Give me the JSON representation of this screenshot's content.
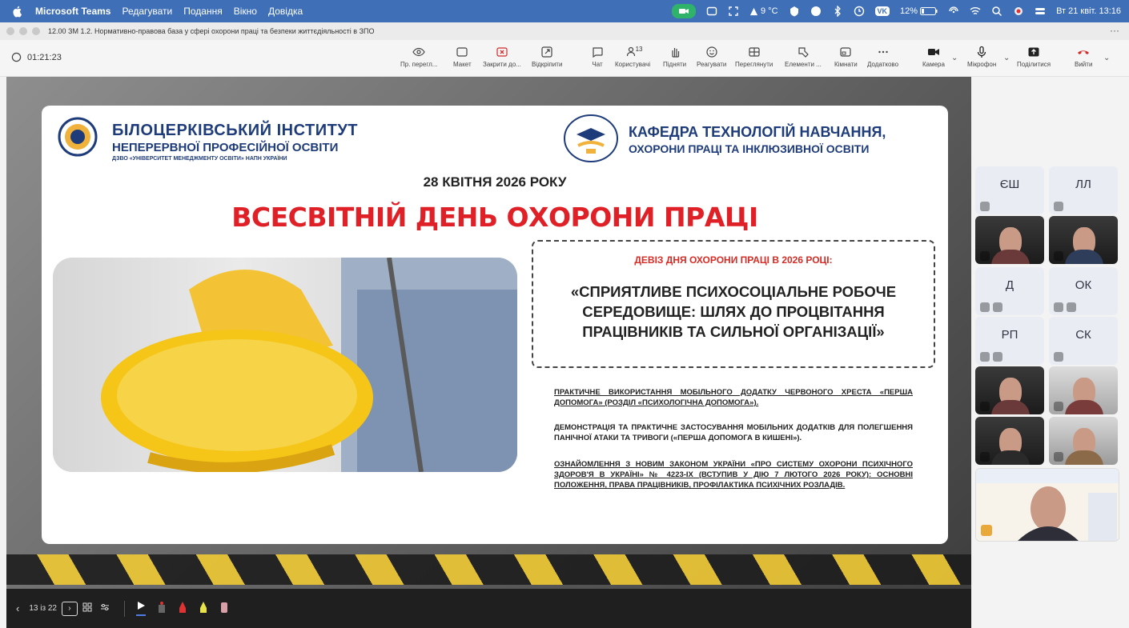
{
  "menubar": {
    "app_name": "Microsoft Teams",
    "items": [
      "Редагувати",
      "Подання",
      "Вікно",
      "Довідка"
    ],
    "temperature": "9 °C",
    "vk_label": "VK",
    "battery": "12%",
    "datetime": "Вт 21 квіт. 13:16"
  },
  "window": {
    "title": "12.00 ЗМ 1.2. Нормативно-правова база у сфері охорони праці та безпеки життєдіяльності в ЗПО",
    "more": "···"
  },
  "toolbar": {
    "timer": "01:21:23",
    "buttons": {
      "preview": "Пр. перегл...",
      "layout": "Макет",
      "close": "Закрити до...",
      "pin": "Відкріпити",
      "chat": "Чат",
      "people": "Користувачі",
      "people_count": "13",
      "raise": "Підняти",
      "react": "Реагувати",
      "view": "Переглянути",
      "elements": "Елементи ...",
      "rooms": "Кімнати",
      "more": "Додатково",
      "camera": "Камера",
      "mic": "Мікрофон",
      "share": "Поділитися",
      "leave": "Вийти"
    }
  },
  "slide": {
    "inst_name": "БІЛОЦЕРКІВСЬКИЙ ІНСТИТУТ",
    "inst_sub": "НЕПЕРЕРВНОЇ ПРОФЕСІЙНОЇ ОСВІТИ",
    "inst_sub2": "ДЗВО «УНІВЕРСИТЕТ МЕНЕДЖМЕНТУ ОСВІТИ» НАПН УКРАЇНИ",
    "dept_line1": "КАФЕДРА ТЕХНОЛОГІЙ НАВЧАННЯ,",
    "dept_line2": "ОХОРОНИ ПРАЦІ ТА ІНКЛЮЗИВНОЇ ОСВІТИ",
    "date": "28 КВІТНЯ 2026 РОКУ",
    "title": "ВСЕСВІТНІЙ ДЕНЬ ОХОРОНИ ПРАЦІ",
    "motto_head": "ДЕВІЗ ДНЯ ОХОРОНИ ПРАЦІ В 2026 РОЦІ:",
    "motto": "«СПРИЯТЛИВЕ ПСИХОСОЦІАЛЬНЕ РОБОЧЕ СЕРЕДОВИЩЕ: ШЛЯХ ДО ПРОЦВІТАННЯ ПРАЦІВНИКІВ ТА СИЛЬНОЇ ОРГАНІЗАЦІЇ»",
    "bullet1": "ПРАКТИЧНЕ ВИКОРИСТАННЯ МОБІЛЬНОГО ДОДАТКУ ЧЕРВОНОГО ХРЕСТА «ПЕРША ДОПОМОГА» (РОЗДІЛ «ПСИХОЛОГІЧНА ДОПОМОГА»).",
    "bullet2": "ДЕМОНСТРАЦІЯ ТА ПРАКТИЧНЕ ЗАСТОСУВАННЯ МОБІЛЬНИХ ДОДАТКІВ ДЛЯ ПОЛЕГШЕННЯ ПАНІЧНОЇ АТАКИ ТА ТРИВОГИ («ПЕРША ДОПОМОГА В КИШЕНІ»).",
    "bullet3": "ОЗНАЙОМЛЕННЯ З НОВИМ ЗАКОНОМ УКРАЇНИ «ПРО СИСТЕМУ ОХОРОНИ ПСИХІЧНОГО ЗДОРОВ'Я В УКРАЇНІ» № 4223-IX (ВСТУПИВ У ДІЮ 7 ЛЮТОГО 2026 РОКУ): ОСНОВНІ ПОЛОЖЕННЯ, ПРАВА ПРАЦІВНИКІВ, ПРОФІЛАКТИКА ПСИХІЧНИХ РОЗЛАДІВ."
  },
  "slide_controls": {
    "page": "13 із 22"
  },
  "participants": {
    "initials": [
      "ЄШ",
      "ЛЛ",
      "Д",
      "ОК",
      "РП",
      "СК"
    ]
  },
  "colors": {
    "menubar": "#3f6fb6",
    "title_red": "#e02027",
    "navy": "#1f3c7a",
    "leave_red": "#d12b2b"
  }
}
